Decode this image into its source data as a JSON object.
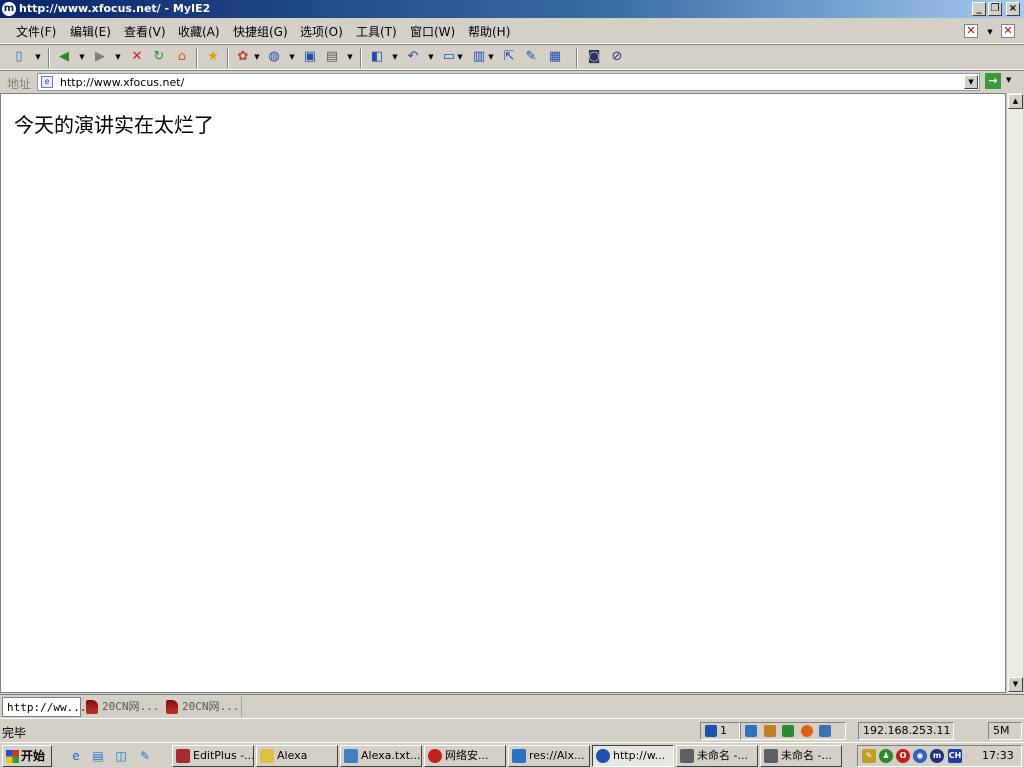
{
  "window": {
    "title": "http://www.xfocus.net/ - MyIE2",
    "app_icon": "myie2-icon"
  },
  "menu": [
    "文件(F)",
    "编辑(E)",
    "查看(V)",
    "收藏(A)",
    "快捷组(G)",
    "选项(O)",
    "工具(T)",
    "窗口(W)",
    "帮助(H)"
  ],
  "toolbar": {
    "icons": [
      "new-page-icon",
      "back-icon",
      "forward-icon",
      "stop-icon",
      "refresh-icon",
      "home-icon",
      "favorites-star-icon",
      "popup-filter-icon",
      "globe-icon",
      "window-icon",
      "sound-icon",
      "open-icon",
      "undo-icon",
      "groups-icon",
      "layout-icon",
      "send-icon",
      "edit-icon",
      "table-icon",
      "snapshot-icon",
      "flash-icon"
    ]
  },
  "address": {
    "label": "地址",
    "url": "http://www.xfocus.net/"
  },
  "content": {
    "text": "今天的演讲实在太烂了"
  },
  "page_tabs": [
    {
      "label": "http://ww...",
      "active": true
    },
    {
      "label": "20CN网...",
      "active": false
    },
    {
      "label": "20CN网...",
      "active": false
    }
  ],
  "status": {
    "text": "完毕",
    "trash_count": "1",
    "ip": "192.168.253.11",
    "memory": "5M"
  },
  "taskbar": {
    "start_label": "开始",
    "tasks": [
      {
        "label": "EditPlus -...",
        "color": "#a03030"
      },
      {
        "label": "Alexa",
        "color": "#e0c040"
      },
      {
        "label": "Alexa.txt...",
        "color": "#4080c0"
      },
      {
        "label": "网络安...",
        "color": "#c02020"
      },
      {
        "label": "res://Alx...",
        "color": "#3070c0"
      },
      {
        "label": "http://w...",
        "color": "#2050b0"
      },
      {
        "label": "未命名 -...",
        "color": "#606060"
      },
      {
        "label": "未命名 -...",
        "color": "#606060"
      }
    ],
    "tray_lang": "CH",
    "clock": "17:33"
  }
}
